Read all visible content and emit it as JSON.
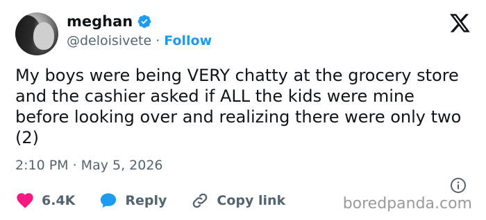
{
  "author": {
    "name": "meghan",
    "handle": "@deloisivete",
    "separator": "·",
    "follow_label": "Follow"
  },
  "tweet": {
    "text": "My boys were being VERY chatty at the grocery store and the cashier asked if ALL the kids were mine before looking over and realizing there were only two (2)",
    "timestamp": "2:10 PM · May 5, 2026"
  },
  "actions": {
    "like_count": "6.4K",
    "reply_label": "Reply",
    "copy_link_label": "Copy link"
  },
  "watermark": "boredpanda.com",
  "colors": {
    "accent": "#1d9bf0",
    "like": "#f91880",
    "text": "#0f1419",
    "muted": "#536471"
  },
  "icons": [
    "verified-badge-icon",
    "x-logo-icon",
    "info-icon",
    "heart-icon",
    "reply-bubble-icon",
    "link-icon"
  ]
}
